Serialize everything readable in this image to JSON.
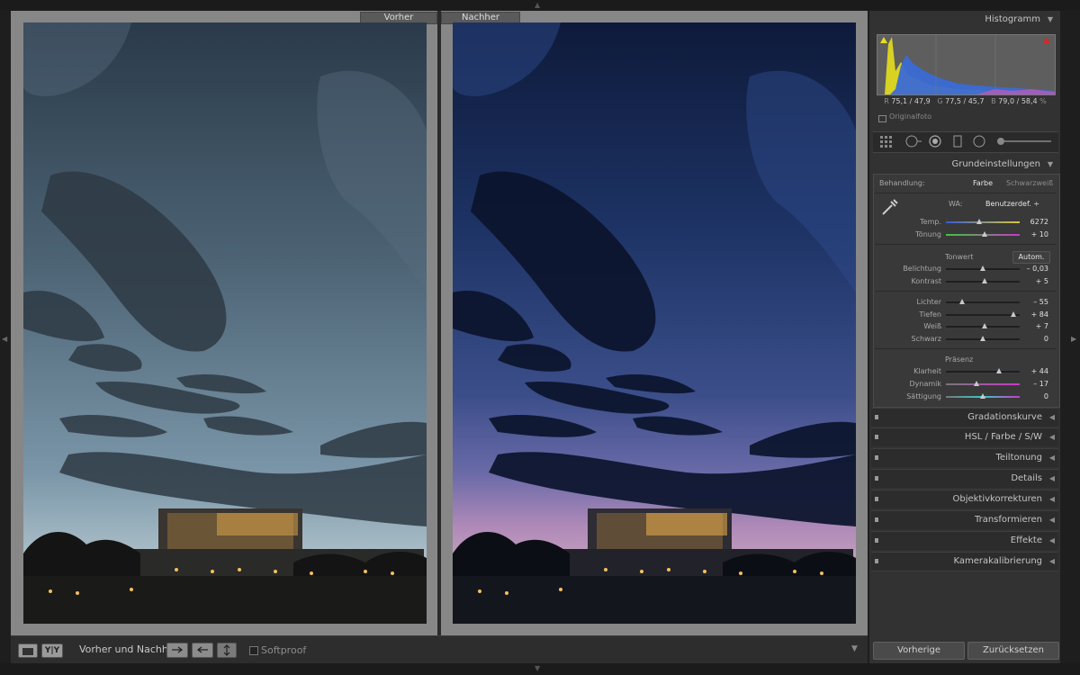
{
  "comparison": {
    "before_label": "Vorher",
    "after_label": "Nachher"
  },
  "toolbar": {
    "view_yy": "Y|Y",
    "mode_label": "Vorher und Nachher:",
    "softproof_label": "Softproof",
    "softproof_checked": false
  },
  "panel": {
    "histogram_title": "Histogramm",
    "readout": {
      "r_label": "R",
      "r_value": "75,1 / 47,9",
      "g_label": "G",
      "g_value": "77,5 / 45,7",
      "b_label": "B",
      "b_value": "79,0 / 58,4",
      "unit": "%"
    },
    "original_photo_label": "Originalfoto",
    "basic_title": "Grundeinstellungen",
    "treatment_label": "Behandlung:",
    "treatment_color": "Farbe",
    "treatment_bw": "Schwarzweiß",
    "wb_label": "WA:",
    "wb_value": "Benutzerdef. ÷",
    "tone_label": "Tonwert",
    "auto_label": "Autom.",
    "presence_label": "Präsenz",
    "sliders": [
      {
        "label": "Temp.",
        "value": "6272",
        "position": 0.45
      },
      {
        "label": "Tönung",
        "value": "+ 10",
        "position": 0.53
      },
      {
        "label": "Belichtung",
        "value": "– 0,03",
        "position": 0.5
      },
      {
        "label": "Kontrast",
        "value": "+ 5",
        "position": 0.52
      },
      {
        "label": "Lichter",
        "value": "– 55",
        "position": 0.22
      },
      {
        "label": "Tiefen",
        "value": "+ 84",
        "position": 0.92
      },
      {
        "label": "Weiß",
        "value": "+ 7",
        "position": 0.53
      },
      {
        "label": "Schwarz",
        "value": "0",
        "position": 0.5
      },
      {
        "label": "Klarheit",
        "value": "+ 44",
        "position": 0.72
      },
      {
        "label": "Dynamik",
        "value": "– 17",
        "position": 0.42
      },
      {
        "label": "Sättigung",
        "value": "0",
        "position": 0.5
      }
    ],
    "collapsed_panels": [
      "Gradationskurve",
      "HSL  /  Farbe  /  S/W",
      "Teiltonung",
      "Details",
      "Objektivkorrekturen",
      "Transformieren",
      "Effekte",
      "Kamerakalibrierung"
    ],
    "prev_button": "Vorherige",
    "reset_button": "Zurücksetzen"
  },
  "colors": {
    "panel_bg": "#323232",
    "canvas_bg": "#878787",
    "histo_yellow": "#e6df1c",
    "histo_blue": "#3a6ad4"
  }
}
